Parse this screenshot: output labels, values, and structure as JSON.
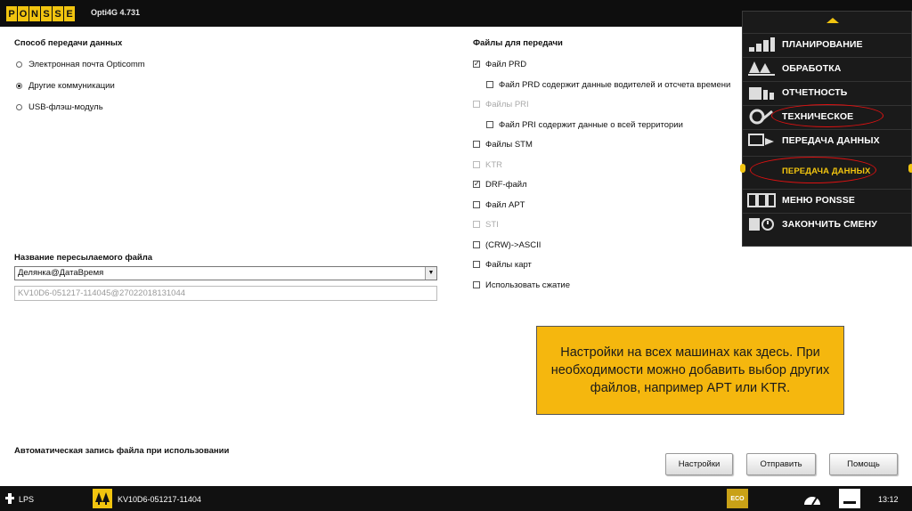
{
  "app": {
    "logo_letters": [
      "P",
      "O",
      "N",
      "S",
      "S",
      "E"
    ],
    "title": "Opti4G 4.731"
  },
  "transfer_method": {
    "heading": "Способ передачи данных",
    "options": [
      {
        "label": "Электронная почта Opticomm",
        "selected": false
      },
      {
        "label": "Другие коммуникации",
        "selected": true
      },
      {
        "label": "USB-флэш-модуль",
        "selected": false
      }
    ]
  },
  "filename": {
    "heading": "Название пересылаемого файла",
    "dropdown_value": "Делянка@ДатаВремя",
    "preview_value": "KV10D6-051217-114045@27022018131044"
  },
  "files": {
    "heading": "Файлы для передачи",
    "items": [
      {
        "label": "Файл PRD",
        "checked": true,
        "enabled": true,
        "indent": 0
      },
      {
        "label": "Файл PRD содержит данные водителей и отсчета времени",
        "checked": false,
        "enabled": true,
        "indent": 1
      },
      {
        "label": "Файлы PRI",
        "checked": false,
        "enabled": false,
        "indent": 0
      },
      {
        "label": "Файл PRI содержит данные о всей территории",
        "checked": false,
        "enabled": true,
        "indent": 1
      },
      {
        "label": "Файлы STM",
        "checked": false,
        "enabled": true,
        "indent": 0
      },
      {
        "label": "KTR",
        "checked": false,
        "enabled": false,
        "indent": 0
      },
      {
        "label": "DRF-файл",
        "checked": true,
        "enabled": true,
        "indent": 0
      },
      {
        "label": "Файл APT",
        "checked": false,
        "enabled": true,
        "indent": 0
      },
      {
        "label": "STI",
        "checked": false,
        "enabled": false,
        "indent": 0
      },
      {
        "label": "(CRW)->ASCII",
        "checked": false,
        "enabled": true,
        "indent": 0
      },
      {
        "label": "Файлы карт",
        "checked": false,
        "enabled": true,
        "indent": 0
      },
      {
        "label": "Использовать сжатие",
        "checked": false,
        "enabled": true,
        "indent": 0
      }
    ]
  },
  "auto_save": {
    "heading": "Автоматическая запись файла при использовании"
  },
  "menu": {
    "items": [
      {
        "label": "ПЛАНИРОВАНИЕ",
        "icon": "signal-bars-icon"
      },
      {
        "label": "ОБРАБОТКА",
        "icon": "forest-icon"
      },
      {
        "label": "ОТЧЕТНОСТЬ",
        "icon": "report-icon"
      },
      {
        "label": "ТЕХНИЧЕСКОЕ",
        "icon": "wrench-icon"
      },
      {
        "label": "ПЕРЕДАЧА ДАННЫХ",
        "icon": "transfer-icon"
      },
      {
        "label": "ПЕРЕДАЧА ДАННЫХ",
        "icon": "",
        "sub": true
      },
      {
        "label": "МЕНЮ PONSSE",
        "icon": "ponsse-logo-icon"
      },
      {
        "label": "ЗАКОНЧИТЬ СМЕНУ",
        "icon": "end-shift-icon"
      }
    ]
  },
  "note": {
    "text": "Настройки на всех машинах как здесь. При необходимости можно добавить выбор других файлов, например APT или KTR."
  },
  "buttons": {
    "settings": "Настройки",
    "send": "Отправить",
    "help": "Помощь"
  },
  "status": {
    "lps": "LPS",
    "site": "KV10D6-051217-11404",
    "eco": "ECO",
    "time": "13:12"
  },
  "colors": {
    "accent": "#f1c40f",
    "highlight_oval": "#dd1111",
    "note_bg": "#f5b70e"
  }
}
